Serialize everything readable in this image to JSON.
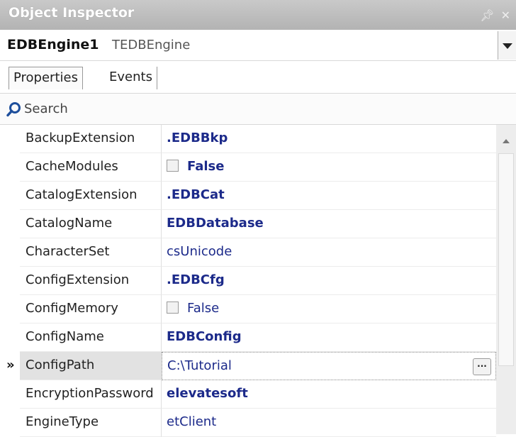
{
  "window": {
    "title": "Object Inspector",
    "pin_icon": "pin-icon",
    "close_icon": "close-icon"
  },
  "selector": {
    "object_name": "EDBEngine1",
    "object_type": "TEDBEngine",
    "dropdown_icon": "chevron-down-icon"
  },
  "tabs": [
    {
      "label": "Properties",
      "active": true
    },
    {
      "label": "Events",
      "active": false
    }
  ],
  "search": {
    "label": "Search",
    "icon": "search-icon"
  },
  "properties": [
    {
      "name": "BackupExtension",
      "value": ".EDBBkp",
      "bold": true
    },
    {
      "name": "CacheModules",
      "value": "False",
      "bold": true,
      "checkbox": true
    },
    {
      "name": "CatalogExtension",
      "value": ".EDBCat",
      "bold": true
    },
    {
      "name": "CatalogName",
      "value": "EDBDatabase",
      "bold": true
    },
    {
      "name": "CharacterSet",
      "value": "csUnicode",
      "bold": false
    },
    {
      "name": "ConfigExtension",
      "value": ".EDBCfg",
      "bold": true
    },
    {
      "name": "ConfigMemory",
      "value": "False",
      "bold": false,
      "checkbox": true
    },
    {
      "name": "ConfigName",
      "value": "EDBConfig",
      "bold": true
    },
    {
      "name": "ConfigPath",
      "value": "C:\\Tutorial",
      "bold": false,
      "selected": true,
      "ellipsis": "..."
    },
    {
      "name": "EncryptionPassword",
      "value": "elevatesoft",
      "bold": true
    },
    {
      "name": "EngineType",
      "value": "etClient",
      "bold": false
    }
  ],
  "selected_marker": "»",
  "colors": {
    "title_bar": "#b8b8b8",
    "value_text": "#1c2a8a",
    "selected_name_bg": "#e2e2e2"
  }
}
